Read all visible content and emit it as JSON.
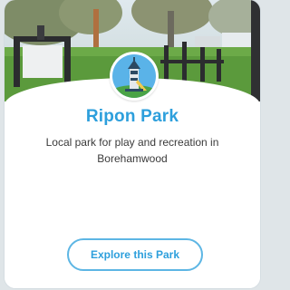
{
  "park": {
    "name": "Ripon Park",
    "description": "Local park for play and recreation in Borehamwood",
    "cta_label": "Explore this Park"
  },
  "icons": {
    "badge": "park-tower-icon"
  },
  "colors": {
    "accent": "#2d9fdc",
    "button_border": "#5db6e4",
    "text": "#3a3a3a",
    "badge_sky": "#5ab3e8",
    "badge_grass": "#4aa346",
    "badge_tower": "#2c4a63"
  }
}
